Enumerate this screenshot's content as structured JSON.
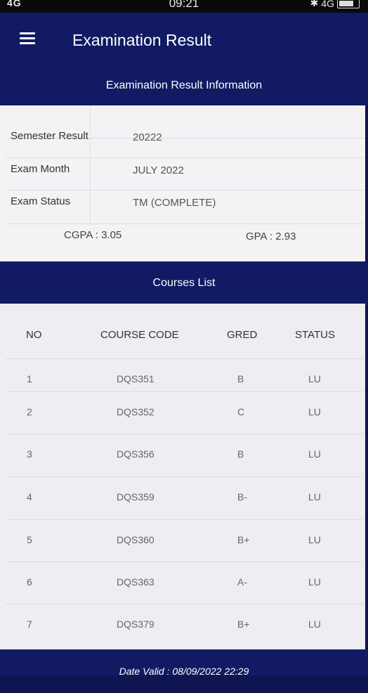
{
  "status_bar": {
    "network": "4G",
    "time": "09:21",
    "network_right": "4G"
  },
  "header": {
    "title": "Examination Result",
    "menu_icon": "hamburger-menu-icon"
  },
  "section_title": "Examination Result Information",
  "info": {
    "semester_label": "Semester Result",
    "semester_value": "20222",
    "month_label": "Exam Month",
    "month_value": "JULY 2022",
    "status_label": "Exam Status",
    "status_value": "TM (COMPLETE)",
    "cgpa": "CGPA : 3.05",
    "gpa": "GPA : 2.93"
  },
  "courses": {
    "title": "Courses List",
    "headers": [
      "NO",
      "COURSE CODE",
      "GRED",
      "STATUS"
    ],
    "rows": [
      {
        "no": "1",
        "code": "DQS351",
        "gred": "B",
        "status": "LU"
      },
      {
        "no": "2",
        "code": "DQS352",
        "gred": "C",
        "status": "LU"
      },
      {
        "no": "3",
        "code": "DQS356",
        "gred": "B",
        "status": "LU"
      },
      {
        "no": "4",
        "code": "DQS359",
        "gred": "B-",
        "status": "LU"
      },
      {
        "no": "5",
        "code": "DQS360",
        "gred": "B+",
        "status": "LU"
      },
      {
        "no": "6",
        "code": "DQS363",
        "gred": "A-",
        "status": "LU"
      },
      {
        "no": "7",
        "code": "DQS379",
        "gred": "B+",
        "status": "LU"
      }
    ]
  },
  "footer": {
    "date_valid": "Date Valid : 08/09/2022 22:29"
  },
  "colors": {
    "primary": "#111a62",
    "background": "#f3f3f5"
  }
}
